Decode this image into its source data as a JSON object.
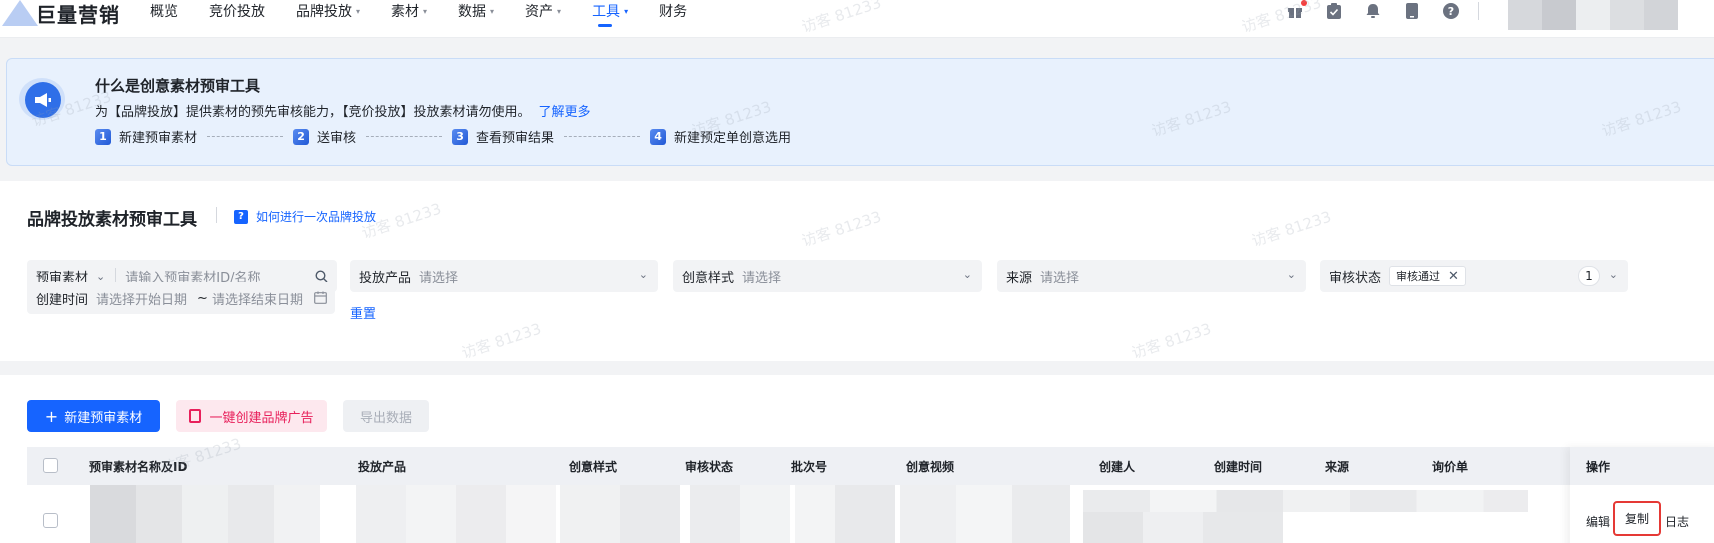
{
  "app": {
    "logo_text": "巨量营销"
  },
  "nav": {
    "items": [
      {
        "label": "概览",
        "dropdown": false,
        "active": false
      },
      {
        "label": "竞价投放",
        "dropdown": false,
        "active": false
      },
      {
        "label": "品牌投放",
        "dropdown": true,
        "active": false
      },
      {
        "label": "素材",
        "dropdown": true,
        "active": false
      },
      {
        "label": "数据",
        "dropdown": true,
        "active": false
      },
      {
        "label": "资产",
        "dropdown": true,
        "active": false
      },
      {
        "label": "工具",
        "dropdown": true,
        "active": true
      },
      {
        "label": "财务",
        "dropdown": false,
        "active": false
      }
    ],
    "caret": "▾"
  },
  "top_icons": [
    "gift-icon",
    "clipboard-check-icon",
    "bell-icon",
    "phone-icon",
    "help-icon"
  ],
  "banner": {
    "title": "什么是创意素材预审工具",
    "description": "为【品牌投放】提供素材的预先审核能力，【竞价投放】投放素材请勿使用。",
    "learn_more": "了解更多",
    "steps": [
      {
        "num": "1",
        "label": "新建预审素材"
      },
      {
        "num": "2",
        "label": "送审核"
      },
      {
        "num": "3",
        "label": "查看预审结果"
      },
      {
        "num": "4",
        "label": "新建预定单创意选用"
      }
    ]
  },
  "panel": {
    "title": "品牌投放素材预审工具",
    "help_link": "如何进行一次品牌投放",
    "filters": {
      "material": {
        "label": "预审素材",
        "placeholder": "请输入预审素材ID/名称"
      },
      "product": {
        "label": "投放产品",
        "placeholder": "请选择"
      },
      "style": {
        "label": "创意样式",
        "placeholder": "请选择"
      },
      "source": {
        "label": "来源",
        "placeholder": "请选择"
      },
      "review_status": {
        "label": "审核状态",
        "tag": "审核通过",
        "count": "1"
      },
      "created_time": {
        "label": "创建时间",
        "start_placeholder": "请选择开始日期",
        "separator": "~",
        "end_placeholder": "请选择结束日期"
      }
    },
    "reset": "重置"
  },
  "toolbar": {
    "new_label": "新建预审素材",
    "brand_ad_label": "一键创建品牌广告",
    "export_label": "导出数据"
  },
  "table": {
    "columns": [
      "预审素材名称及ID",
      "投放产品",
      "创意样式",
      "审核状态",
      "批次号",
      "创意视频",
      "创建人",
      "创建时间",
      "来源",
      "询价单"
    ],
    "actions_header": "操作",
    "row_actions": {
      "edit": "编辑",
      "copy": "复制",
      "log": "日志"
    }
  },
  "watermark": "访客 81233",
  "colors": {
    "accent": "#1664ff",
    "banner_bg": "#e8f1fd",
    "pink": "#e8205b",
    "highlight": "#e53935"
  }
}
